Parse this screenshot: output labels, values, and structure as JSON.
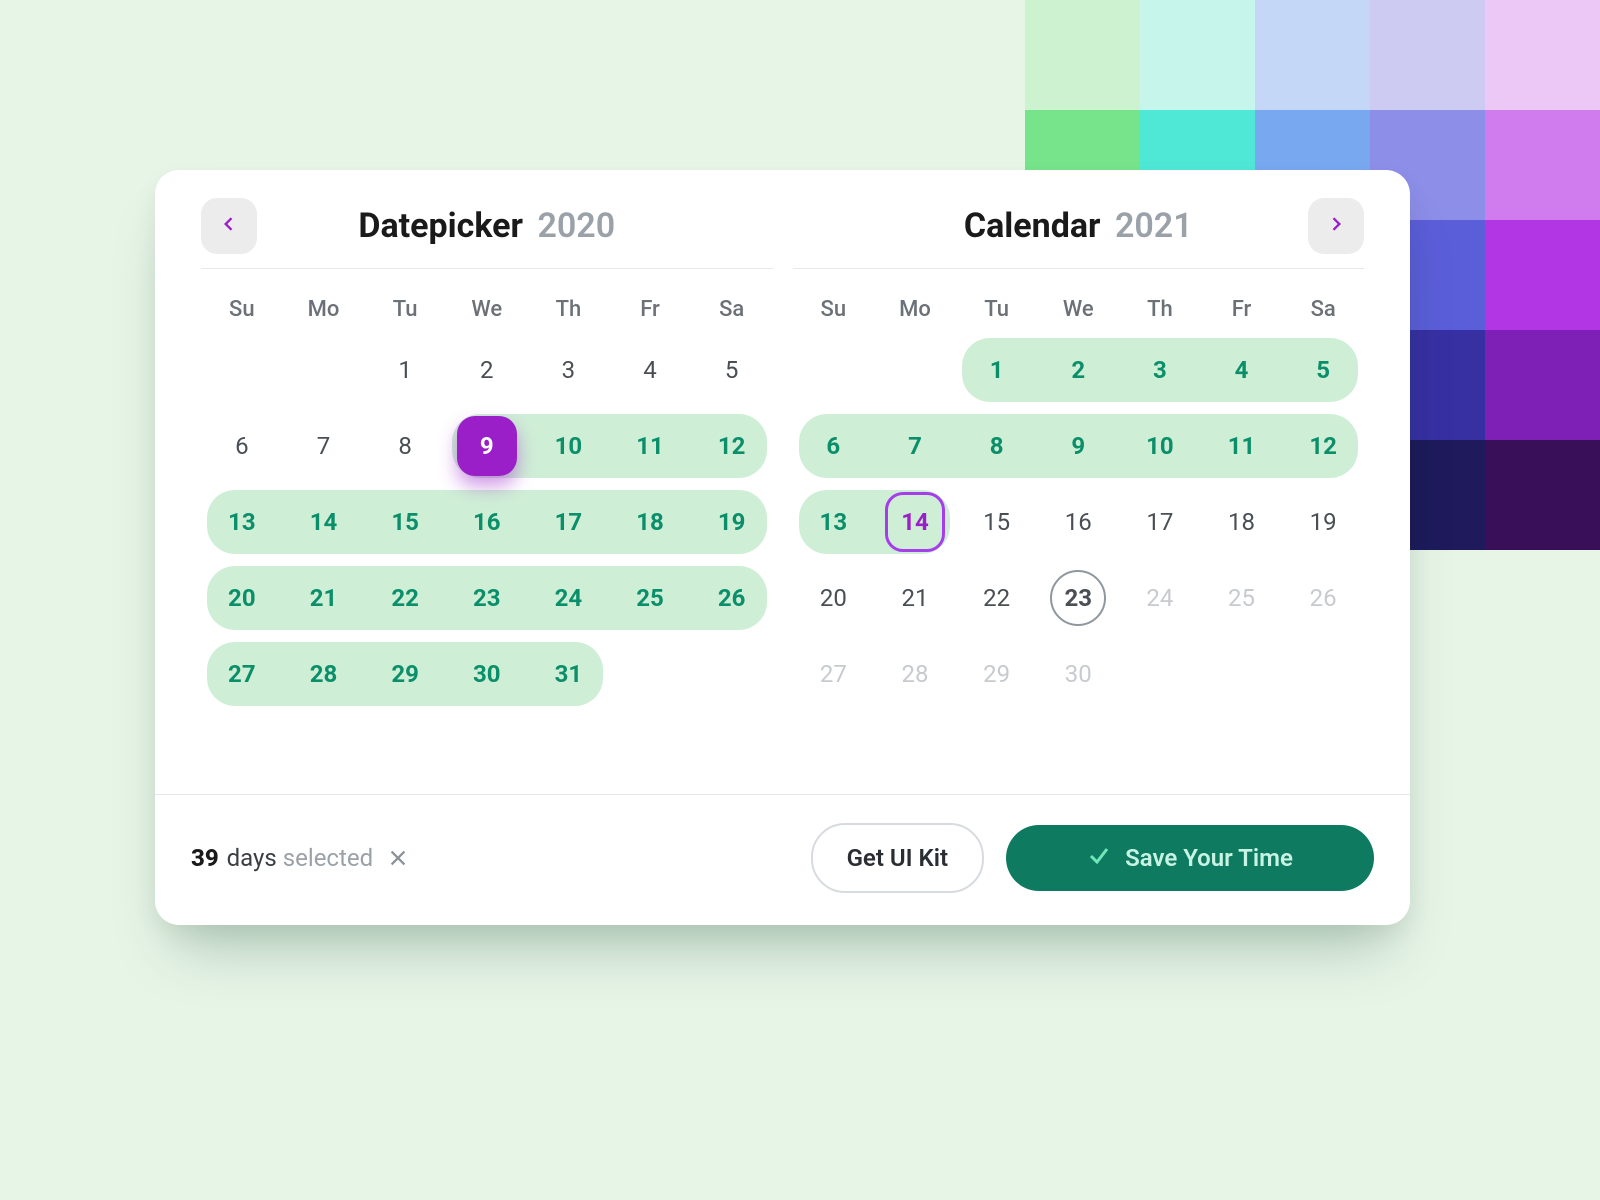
{
  "palette": {
    "rows": [
      [
        "#cdf2cf",
        "#c6f5ec",
        "#c5d7f7",
        "#cdcbf2",
        "#ebc8f5"
      ],
      [
        "#77e38a",
        "#4fe7d6",
        "#78a8f0",
        "#8d8ee8",
        "#d07bee"
      ],
      [
        "#3fc94d",
        "#16cfc9",
        "#3f76e6",
        "#5b5ed9",
        "#b236e3"
      ],
      [
        "#1f9d36",
        "#0f8f97",
        "#244bb8",
        "#3730a3",
        "#7e1fb6"
      ],
      [
        "#0f5f25",
        "#0a4a57",
        "#142a6b",
        "#1e1a5c",
        "#3a0f5a"
      ]
    ]
  },
  "dow": [
    "Su",
    "Mo",
    "Tu",
    "We",
    "Th",
    "Fr",
    "Sa"
  ],
  "left": {
    "title": "Datepicker",
    "year": "2020",
    "cells": [
      {
        "n": "",
        "t": "empty"
      },
      {
        "n": "",
        "t": "empty"
      },
      {
        "n": "1",
        "t": "other"
      },
      {
        "n": "2",
        "t": "other"
      },
      {
        "n": "3",
        "t": "other"
      },
      {
        "n": "4",
        "t": "other"
      },
      {
        "n": "5",
        "t": "other"
      },
      {
        "n": "6",
        "t": "other"
      },
      {
        "n": "7",
        "t": "other"
      },
      {
        "n": "8",
        "t": "other"
      },
      {
        "n": "9",
        "t": "sel-start start row-start in-range"
      },
      {
        "n": "10",
        "t": "in-range"
      },
      {
        "n": "11",
        "t": "in-range"
      },
      {
        "n": "12",
        "t": "in-range row-end"
      },
      {
        "n": "13",
        "t": "in-range row-start"
      },
      {
        "n": "14",
        "t": "in-range"
      },
      {
        "n": "15",
        "t": "in-range"
      },
      {
        "n": "16",
        "t": "in-range"
      },
      {
        "n": "17",
        "t": "in-range"
      },
      {
        "n": "18",
        "t": "in-range"
      },
      {
        "n": "19",
        "t": "in-range row-end"
      },
      {
        "n": "20",
        "t": "in-range row-start"
      },
      {
        "n": "21",
        "t": "in-range"
      },
      {
        "n": "22",
        "t": "in-range"
      },
      {
        "n": "23",
        "t": "in-range"
      },
      {
        "n": "24",
        "t": "in-range"
      },
      {
        "n": "25",
        "t": "in-range"
      },
      {
        "n": "26",
        "t": "in-range row-end"
      },
      {
        "n": "27",
        "t": "in-range row-start"
      },
      {
        "n": "28",
        "t": "in-range"
      },
      {
        "n": "29",
        "t": "in-range"
      },
      {
        "n": "30",
        "t": "in-range"
      },
      {
        "n": "31",
        "t": "in-range row-end end"
      },
      {
        "n": "",
        "t": "empty"
      },
      {
        "n": "",
        "t": "empty"
      }
    ]
  },
  "right": {
    "title": "Calendar",
    "year": "2021",
    "cells": [
      {
        "n": "",
        "t": "empty"
      },
      {
        "n": "",
        "t": "empty"
      },
      {
        "n": "1",
        "t": "in-range row-start start"
      },
      {
        "n": "2",
        "t": "in-range"
      },
      {
        "n": "3",
        "t": "in-range"
      },
      {
        "n": "4",
        "t": "in-range"
      },
      {
        "n": "5",
        "t": "in-range row-end"
      },
      {
        "n": "6",
        "t": "in-range row-start"
      },
      {
        "n": "7",
        "t": "in-range"
      },
      {
        "n": "8",
        "t": "in-range"
      },
      {
        "n": "9",
        "t": "in-range"
      },
      {
        "n": "10",
        "t": "in-range"
      },
      {
        "n": "11",
        "t": "in-range"
      },
      {
        "n": "12",
        "t": "in-range row-end"
      },
      {
        "n": "13",
        "t": "in-range row-start"
      },
      {
        "n": "14",
        "t": "sel-end in-range end row-end"
      },
      {
        "n": "15",
        "t": "other"
      },
      {
        "n": "16",
        "t": "other"
      },
      {
        "n": "17",
        "t": "other"
      },
      {
        "n": "18",
        "t": "other"
      },
      {
        "n": "19",
        "t": "other"
      },
      {
        "n": "20",
        "t": "other"
      },
      {
        "n": "21",
        "t": "other"
      },
      {
        "n": "22",
        "t": "other"
      },
      {
        "n": "23",
        "t": "today other"
      },
      {
        "n": "24",
        "t": "dis"
      },
      {
        "n": "25",
        "t": "dis"
      },
      {
        "n": "26",
        "t": "dis"
      },
      {
        "n": "27",
        "t": "dis"
      },
      {
        "n": "28",
        "t": "dis"
      },
      {
        "n": "29",
        "t": "dis"
      },
      {
        "n": "30",
        "t": "dis"
      },
      {
        "n": "",
        "t": "empty"
      },
      {
        "n": "",
        "t": "empty"
      },
      {
        "n": "",
        "t": "empty"
      }
    ]
  },
  "footer": {
    "count": "39",
    "days_label": "days",
    "selected_label": "selected",
    "secondary": "Get UI Kit",
    "primary": "Save Your Time"
  }
}
